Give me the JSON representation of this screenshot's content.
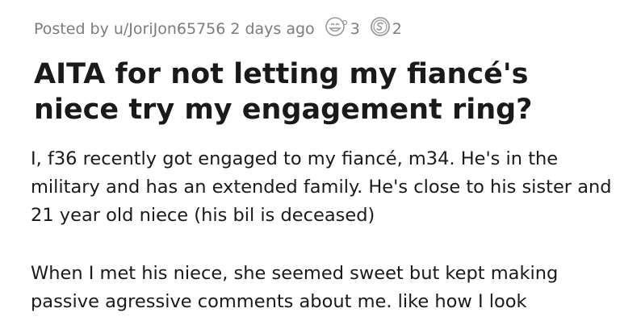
{
  "post": {
    "posted_by_prefix": "Posted by",
    "author": "u/JoriJon65756",
    "time_ago": "2 days ago",
    "award_1_count": "3",
    "award_2_count": "2",
    "title": "AITA for not letting my fiancé's niece try my engagement ring?",
    "body": [
      "I, f36 recently got engaged to my fiancé, m34. He's in the military and has an extended family. He's close to his sister and 21 year old niece (his bil is deceased)",
      "When I met his niece, she seemed sweet but kept making passive agressive comments about me. like how I look"
    ]
  },
  "icons": {
    "award_1": "laughing-award-icon",
    "award_2": "silver-coin-award-icon"
  },
  "colors": {
    "meta_text": "#7c7c7c",
    "title_text": "#1a1a1b",
    "body_text": "#1a1a1b"
  }
}
